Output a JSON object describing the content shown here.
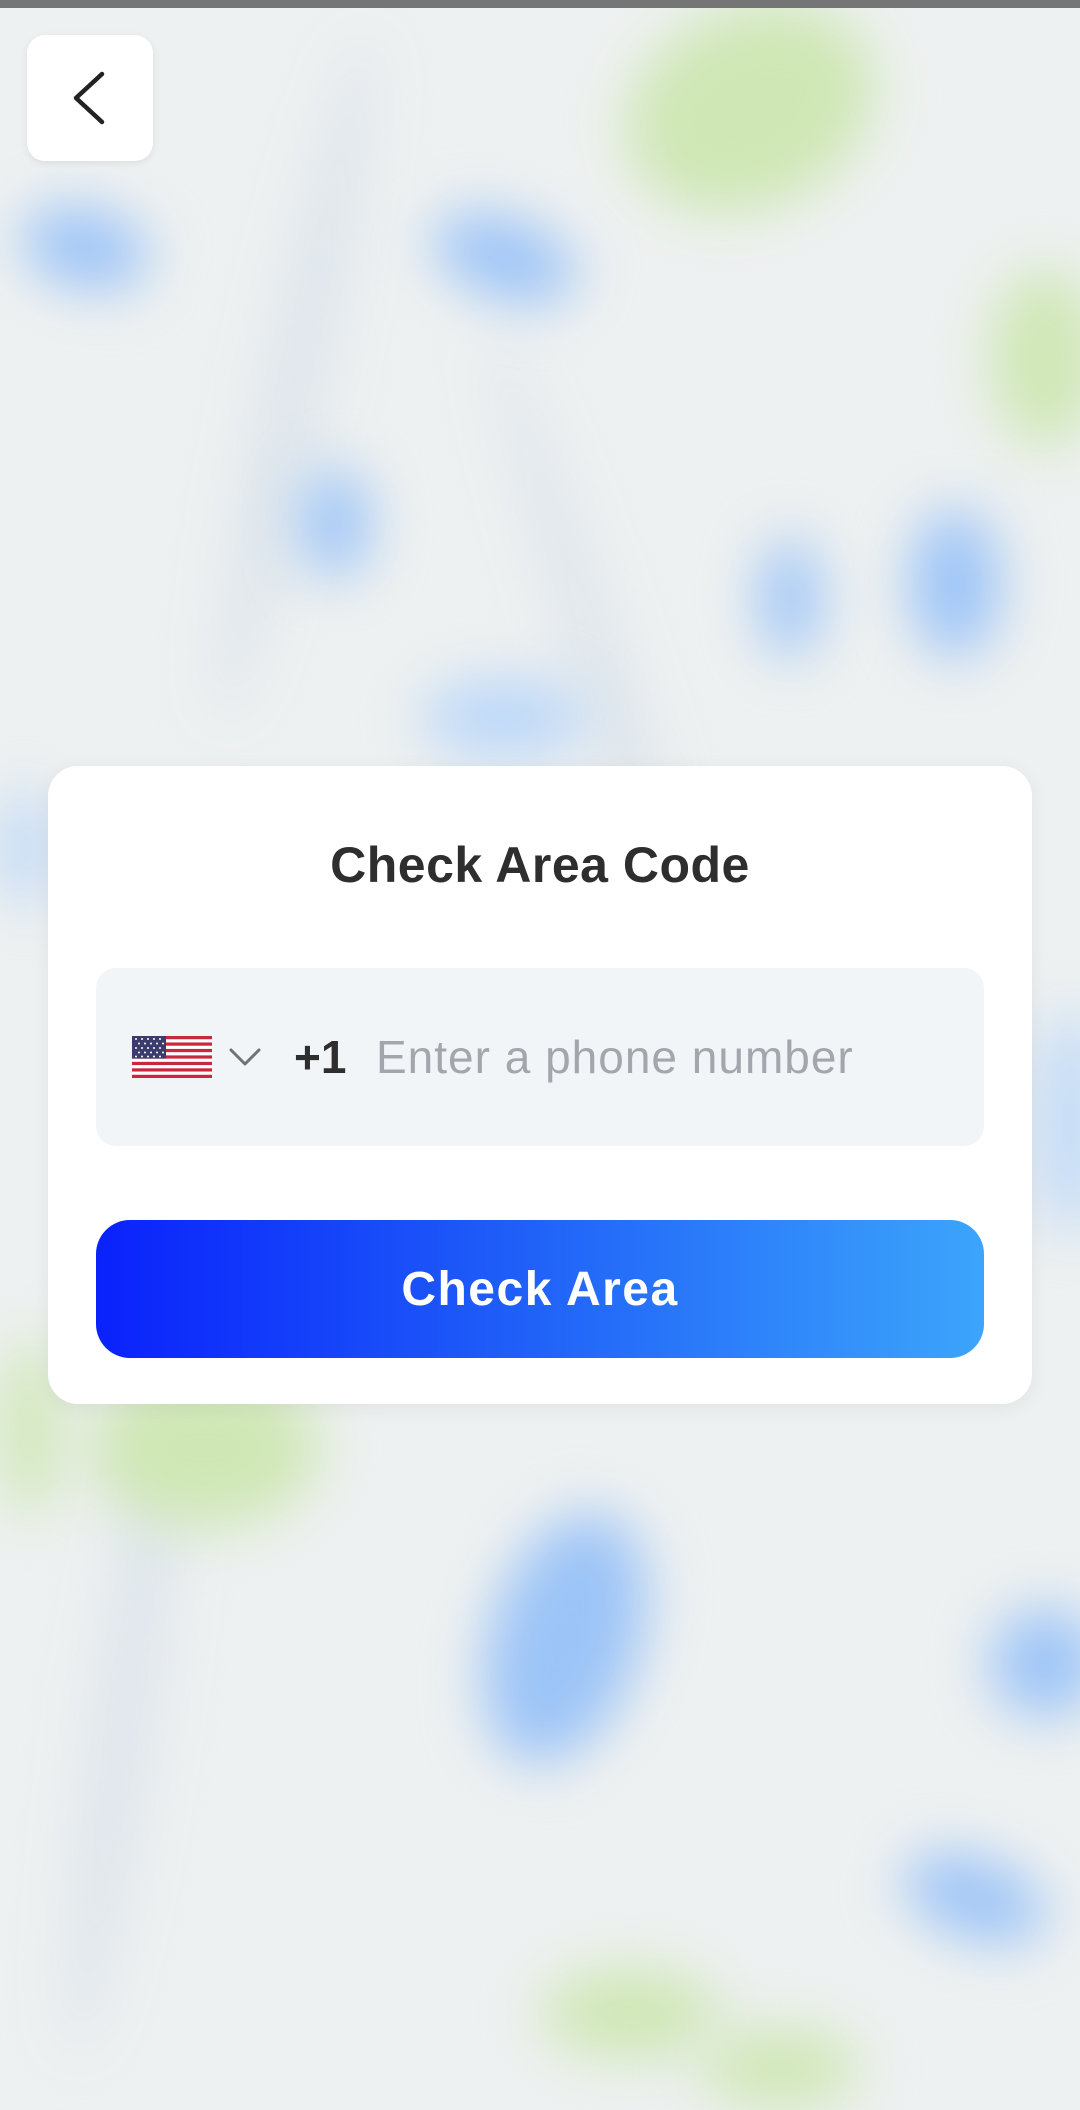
{
  "card": {
    "title": "Check Area Code",
    "phone": {
      "country": "United States",
      "dial_code": "+1",
      "placeholder": "Enter a phone number",
      "value": ""
    },
    "submit_label": "Check Area"
  },
  "colors": {
    "accent_start": "#0a21fb",
    "accent_end": "#3ca5fb",
    "title_text": "#2e2e2e",
    "field_bg": "#f2f5f8",
    "placeholder": "#a3a7ad"
  },
  "icons": {
    "back": "chevron-left-icon",
    "flag": "us-flag-icon",
    "dropdown": "chevron-down-icon"
  }
}
